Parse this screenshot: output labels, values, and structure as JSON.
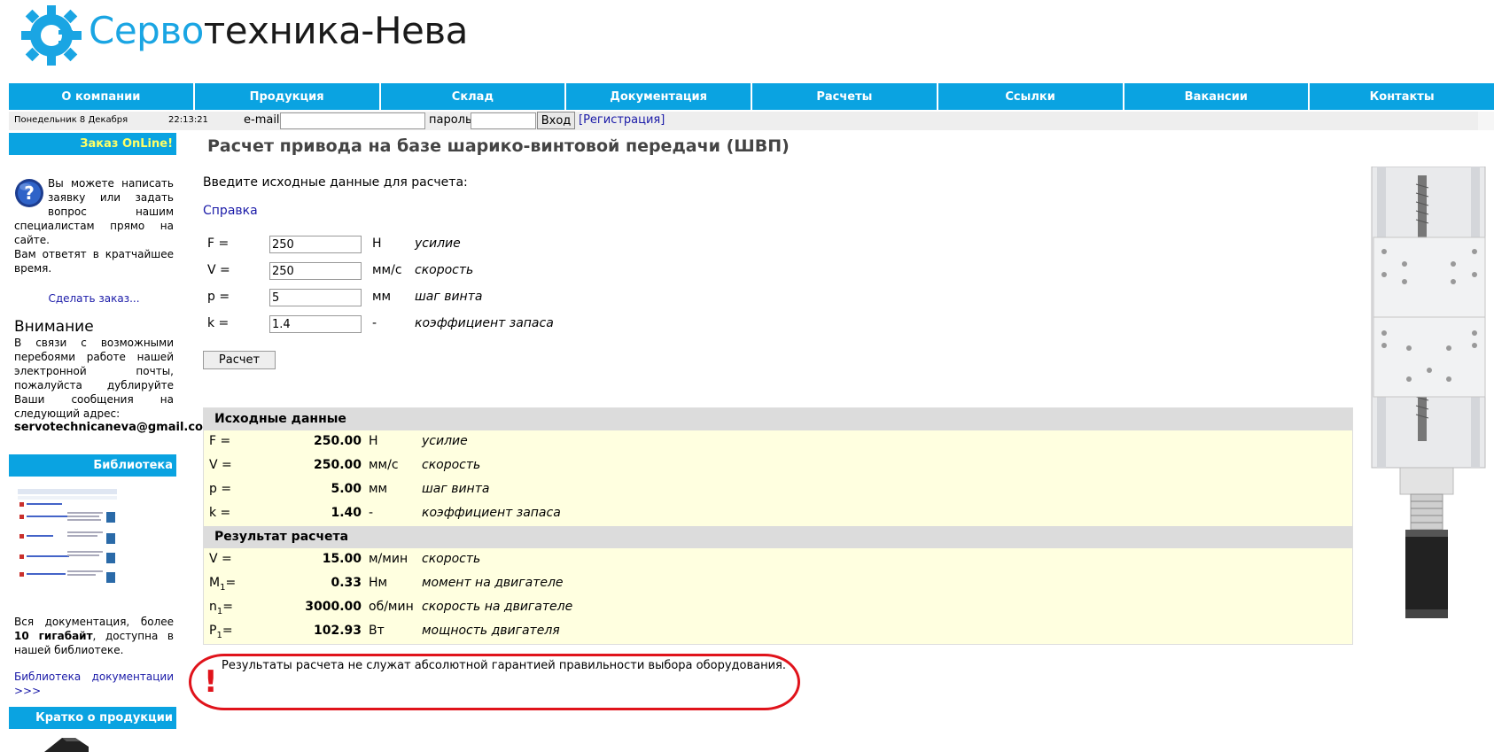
{
  "logo": {
    "text_accent": "Серво",
    "text_rest": "техника-Нева"
  },
  "nav": [
    "О компании",
    "Продукция",
    "Склад",
    "Документация",
    "Расчеты",
    "Ссылки",
    "Вакансии",
    "Контакты"
  ],
  "status": {
    "date": "Понедельник  8 Декабря",
    "time": "22:13:21",
    "email_label": "e-mail:",
    "email_value": "",
    "password_label": "пароль:",
    "password_value": "",
    "login_button": "Вход",
    "register_link": "[Регистрация]"
  },
  "sidebar": {
    "order_title": "Заказ OnLine!",
    "order_text": "Вы можете написать заявку или задать вопрос нашим специалистам прямо на сайте.",
    "order_text2": "Вам ответят в кратчайшее время.",
    "order_link": "Сделать заказ...",
    "attention_title": "Внимание",
    "attention_text": "В связи с возможными перебоями работе нашей электронной почты, пожалуйста дублируйте Ваши сообщения на следующий адрес:",
    "attention_email": "servotechnicaneva@gmail.com",
    "library_title": "Библиотека",
    "library_text_a": "Вся документация, более ",
    "library_text_bold": "10 гигабайт",
    "library_text_b": ", доступна в нашей библиотеке.",
    "library_link": "Библиотека документации >>>",
    "products_title": "Кратко о продукции"
  },
  "main": {
    "title": "Расчет привода на базе шарико-винтовой передачи (ШВП)",
    "intro": "Введите исходные данные для расчета:",
    "help_link": "Справка",
    "params": [
      {
        "label": "F =",
        "value": "250",
        "unit": "Н",
        "desc": "усилие"
      },
      {
        "label": "V =",
        "value": "250",
        "unit": "мм/с",
        "desc": "скорость"
      },
      {
        "label": "p =",
        "value": "5",
        "unit": "мм",
        "desc": "шаг винта"
      },
      {
        "label": "k =",
        "value": "1.4",
        "unit": "-",
        "desc": "коэффициент запаса"
      }
    ],
    "calc_button": "Расчет",
    "input_section_title": "Исходные данные",
    "input_rows": [
      {
        "label": "F =",
        "value": "250.00",
        "unit": "Н",
        "desc": "усилие"
      },
      {
        "label": "V =",
        "value": "250.00",
        "unit": "мм/с",
        "desc": "скорость"
      },
      {
        "label": "p =",
        "value": "5.00",
        "unit": "мм",
        "desc": "шаг винта"
      },
      {
        "label": "k =",
        "value": "1.40",
        "unit": "-",
        "desc": "коэффициент запаса"
      }
    ],
    "result_section_title": "Результат расчета",
    "result_rows": [
      {
        "label": "V =",
        "sub": "",
        "value": "15.00",
        "unit": "м/мин",
        "desc": "скорость"
      },
      {
        "label": "M",
        "sub": "1",
        "suffix": "=",
        "value": "0.33",
        "unit": "Нм",
        "desc": "момент на двигателе"
      },
      {
        "label": "n",
        "sub": "1",
        "suffix": "=",
        "value": "3000.00",
        "unit": "об/мин",
        "desc": "скорость на двигателе"
      },
      {
        "label": "P",
        "sub": "1",
        "suffix": "=",
        "value": "102.93",
        "unit": "Вт",
        "desc": "мощность двигателя"
      }
    ],
    "warning_mark": "!",
    "warning_text": "Результаты расчета не служат абсолютной гарантией правильности выбора оборудования."
  },
  "colors": {
    "nav_bg": "#0aa3e1",
    "accent": "#1aa5e3",
    "table_bg": "#ffffe0",
    "warning": "#e0131b",
    "order_title": "#ffff66"
  }
}
